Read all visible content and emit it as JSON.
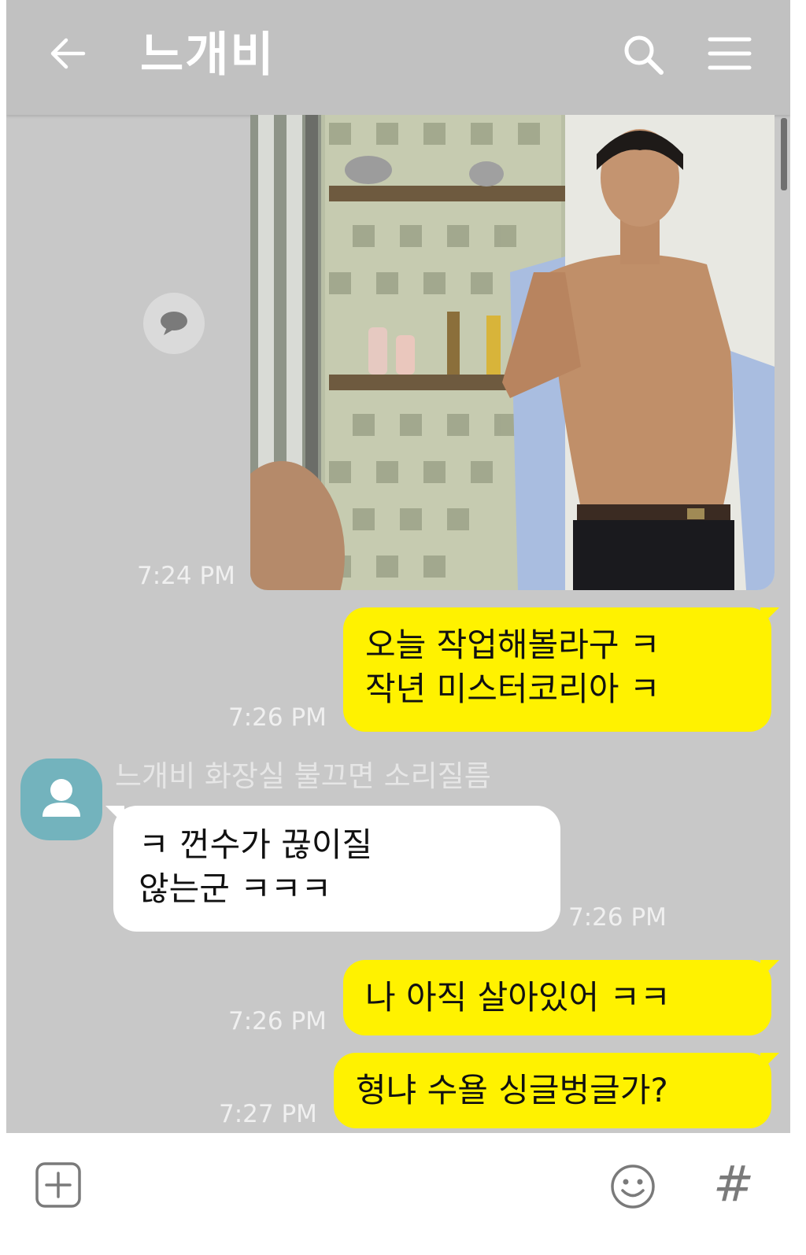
{
  "header": {
    "title": "느개비",
    "back_icon": "arrow-left-icon",
    "search_icon": "search-icon",
    "menu_icon": "hamburger-menu-icon"
  },
  "messages": [
    {
      "type": "image",
      "side": "me",
      "time": "7:24 PM",
      "description_icon": "photo-message"
    },
    {
      "type": "text",
      "side": "me",
      "lines": [
        "오늘 작업해볼라구 ㅋ",
        "작년 미스터코리아 ㅋ"
      ],
      "time": "7:26 PM"
    },
    {
      "type": "text",
      "side": "other",
      "sender": "느개비 화장실 불끄면 소리질름",
      "lines": [
        "ㅋ 껀수가 끊이질",
        "않는군 ㅋㅋㅋ"
      ],
      "time": "7:26 PM"
    },
    {
      "type": "text",
      "side": "me",
      "lines": [
        "나 아직 살아있어 ㅋㅋ"
      ],
      "time": "7:26 PM"
    },
    {
      "type": "text",
      "side": "me",
      "lines": [
        "형냐 수욜 싱글벙글가?"
      ],
      "time": "7:27 PM"
    }
  ],
  "input_bar": {
    "plus_icon": "plus-square-icon",
    "emoji_icon": "smiley-icon",
    "hash_label": "#"
  },
  "colors": {
    "my_bubble": "#fff200",
    "other_bubble": "#ffffff",
    "header_bg": "#c1c1c1",
    "chat_bg": "#c8c8c8",
    "avatar_bg": "#73b3bd"
  }
}
